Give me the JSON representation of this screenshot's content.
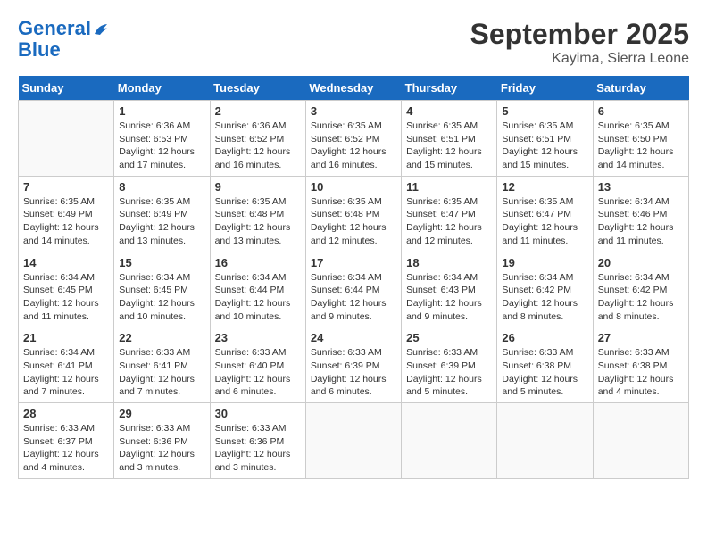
{
  "header": {
    "logo_line1": "General",
    "logo_line2": "Blue",
    "month": "September 2025",
    "location": "Kayima, Sierra Leone"
  },
  "days_of_week": [
    "Sunday",
    "Monday",
    "Tuesday",
    "Wednesday",
    "Thursday",
    "Friday",
    "Saturday"
  ],
  "weeks": [
    [
      {
        "day": "",
        "info": ""
      },
      {
        "day": "1",
        "info": "Sunrise: 6:36 AM\nSunset: 6:53 PM\nDaylight: 12 hours\nand 17 minutes."
      },
      {
        "day": "2",
        "info": "Sunrise: 6:36 AM\nSunset: 6:52 PM\nDaylight: 12 hours\nand 16 minutes."
      },
      {
        "day": "3",
        "info": "Sunrise: 6:35 AM\nSunset: 6:52 PM\nDaylight: 12 hours\nand 16 minutes."
      },
      {
        "day": "4",
        "info": "Sunrise: 6:35 AM\nSunset: 6:51 PM\nDaylight: 12 hours\nand 15 minutes."
      },
      {
        "day": "5",
        "info": "Sunrise: 6:35 AM\nSunset: 6:51 PM\nDaylight: 12 hours\nand 15 minutes."
      },
      {
        "day": "6",
        "info": "Sunrise: 6:35 AM\nSunset: 6:50 PM\nDaylight: 12 hours\nand 14 minutes."
      }
    ],
    [
      {
        "day": "7",
        "info": "Sunrise: 6:35 AM\nSunset: 6:49 PM\nDaylight: 12 hours\nand 14 minutes."
      },
      {
        "day": "8",
        "info": "Sunrise: 6:35 AM\nSunset: 6:49 PM\nDaylight: 12 hours\nand 13 minutes."
      },
      {
        "day": "9",
        "info": "Sunrise: 6:35 AM\nSunset: 6:48 PM\nDaylight: 12 hours\nand 13 minutes."
      },
      {
        "day": "10",
        "info": "Sunrise: 6:35 AM\nSunset: 6:48 PM\nDaylight: 12 hours\nand 12 minutes."
      },
      {
        "day": "11",
        "info": "Sunrise: 6:35 AM\nSunset: 6:47 PM\nDaylight: 12 hours\nand 12 minutes."
      },
      {
        "day": "12",
        "info": "Sunrise: 6:35 AM\nSunset: 6:47 PM\nDaylight: 12 hours\nand 11 minutes."
      },
      {
        "day": "13",
        "info": "Sunrise: 6:34 AM\nSunset: 6:46 PM\nDaylight: 12 hours\nand 11 minutes."
      }
    ],
    [
      {
        "day": "14",
        "info": "Sunrise: 6:34 AM\nSunset: 6:45 PM\nDaylight: 12 hours\nand 11 minutes."
      },
      {
        "day": "15",
        "info": "Sunrise: 6:34 AM\nSunset: 6:45 PM\nDaylight: 12 hours\nand 10 minutes."
      },
      {
        "day": "16",
        "info": "Sunrise: 6:34 AM\nSunset: 6:44 PM\nDaylight: 12 hours\nand 10 minutes."
      },
      {
        "day": "17",
        "info": "Sunrise: 6:34 AM\nSunset: 6:44 PM\nDaylight: 12 hours\nand 9 minutes."
      },
      {
        "day": "18",
        "info": "Sunrise: 6:34 AM\nSunset: 6:43 PM\nDaylight: 12 hours\nand 9 minutes."
      },
      {
        "day": "19",
        "info": "Sunrise: 6:34 AM\nSunset: 6:42 PM\nDaylight: 12 hours\nand 8 minutes."
      },
      {
        "day": "20",
        "info": "Sunrise: 6:34 AM\nSunset: 6:42 PM\nDaylight: 12 hours\nand 8 minutes."
      }
    ],
    [
      {
        "day": "21",
        "info": "Sunrise: 6:34 AM\nSunset: 6:41 PM\nDaylight: 12 hours\nand 7 minutes."
      },
      {
        "day": "22",
        "info": "Sunrise: 6:33 AM\nSunset: 6:41 PM\nDaylight: 12 hours\nand 7 minutes."
      },
      {
        "day": "23",
        "info": "Sunrise: 6:33 AM\nSunset: 6:40 PM\nDaylight: 12 hours\nand 6 minutes."
      },
      {
        "day": "24",
        "info": "Sunrise: 6:33 AM\nSunset: 6:39 PM\nDaylight: 12 hours\nand 6 minutes."
      },
      {
        "day": "25",
        "info": "Sunrise: 6:33 AM\nSunset: 6:39 PM\nDaylight: 12 hours\nand 5 minutes."
      },
      {
        "day": "26",
        "info": "Sunrise: 6:33 AM\nSunset: 6:38 PM\nDaylight: 12 hours\nand 5 minutes."
      },
      {
        "day": "27",
        "info": "Sunrise: 6:33 AM\nSunset: 6:38 PM\nDaylight: 12 hours\nand 4 minutes."
      }
    ],
    [
      {
        "day": "28",
        "info": "Sunrise: 6:33 AM\nSunset: 6:37 PM\nDaylight: 12 hours\nand 4 minutes."
      },
      {
        "day": "29",
        "info": "Sunrise: 6:33 AM\nSunset: 6:36 PM\nDaylight: 12 hours\nand 3 minutes."
      },
      {
        "day": "30",
        "info": "Sunrise: 6:33 AM\nSunset: 6:36 PM\nDaylight: 12 hours\nand 3 minutes."
      },
      {
        "day": "",
        "info": ""
      },
      {
        "day": "",
        "info": ""
      },
      {
        "day": "",
        "info": ""
      },
      {
        "day": "",
        "info": ""
      }
    ]
  ]
}
